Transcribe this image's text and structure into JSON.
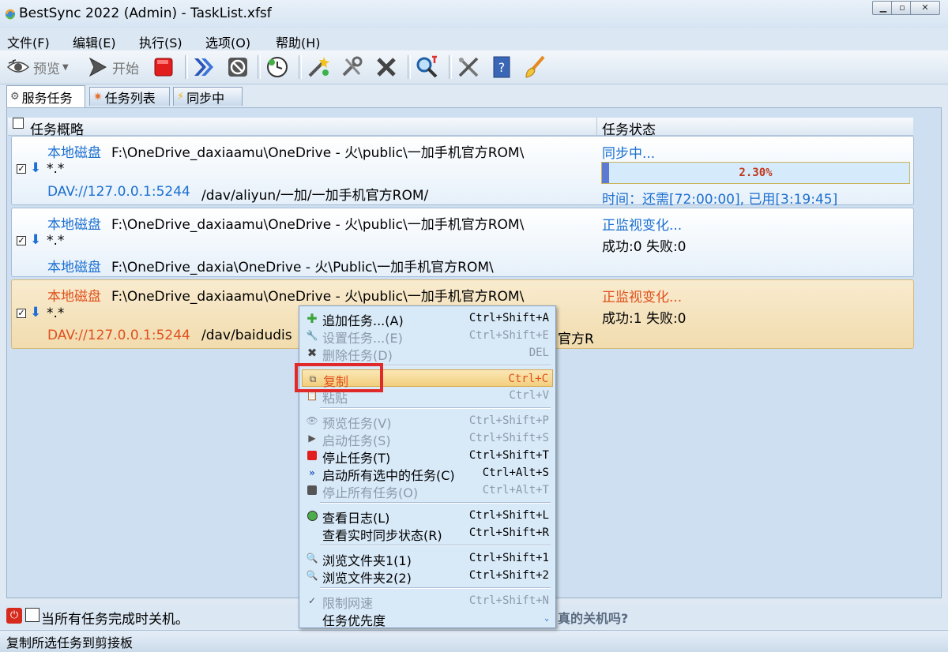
{
  "window": {
    "title": "BestSync 2022 (Admin) - TaskList.xfsf"
  },
  "menu": [
    "文件(F)",
    "编辑(E)",
    "执行(S)",
    "选项(O)",
    "帮助(H)"
  ],
  "toolbar": {
    "preview_label": "预览",
    "start_label": "开始"
  },
  "tabs": [
    "服务任务",
    "任务列表",
    "同步中"
  ],
  "table": {
    "col_overview": "任务概略",
    "col_status": "任务状态"
  },
  "tasks": [
    {
      "src_label": "本地磁盘",
      "src_path": "F:\\OneDrive_daxiaamu\\OneDrive - 火\\public\\一加手机官方ROM\\",
      "filter": "*.*",
      "dst_label": "DAV://127.0.0.1:5244",
      "dst_path": "/dav/aliyun/一加/一加手机官方ROM/",
      "status": "同步中...",
      "progress_text": "2.30%",
      "progress": 0.023,
      "time": "时间：还需[72:00:00], 已用[3:19:45]"
    },
    {
      "src_label": "本地磁盘",
      "src_path": "F:\\OneDrive_daxiaamu\\OneDrive - 火\\public\\一加手机官方ROM\\",
      "filter": "*.*",
      "dst_label": "本地磁盘",
      "dst_path": "F:\\OneDrive_daxia\\OneDrive - 火\\Public\\一加手机官方ROM\\",
      "status": "正监视变化...",
      "result": "成功:0 失败:0"
    },
    {
      "src_label": "本地磁盘",
      "src_path": "F:\\OneDrive_daxiaamu\\OneDrive - 火\\public\\一加手机官方ROM\\",
      "filter": "*.*",
      "dst_label": "DAV://127.0.0.1:5244",
      "dst_path": "/dav/baidudis",
      "dst_tail": "官方R",
      "status": "正监视变化...",
      "result": "成功:1 失败:0"
    }
  ],
  "bottom": {
    "shutdown_label": "当所有任务完成时关机。",
    "confirm_tail": "真的关机吗?"
  },
  "statusbar": {
    "text": "复制所选任务到剪接板"
  },
  "context_menu": {
    "add": {
      "label": "追加任务...(A)",
      "shortcut": "Ctrl+Shift+A"
    },
    "settings": {
      "label": "设置任务...(E)",
      "shortcut": "Ctrl+Shift+E"
    },
    "delete": {
      "label": "删除任务(D)",
      "shortcut": "DEL"
    },
    "copy": {
      "label": "复制",
      "shortcut": "Ctrl+C"
    },
    "paste": {
      "label": "粘贴",
      "shortcut": "Ctrl+V"
    },
    "preview": {
      "label": "预览任务(V)",
      "shortcut": "Ctrl+Shift+P"
    },
    "start": {
      "label": "启动任务(S)",
      "shortcut": "Ctrl+Shift+S"
    },
    "stop": {
      "label": "停止任务(T)",
      "shortcut": "Ctrl+Shift+T"
    },
    "start_all": {
      "label": "启动所有选中的任务(C)",
      "shortcut": "Ctrl+Alt+S"
    },
    "stop_all": {
      "label": "停止所有任务(O)",
      "shortcut": "Ctrl+Alt+T"
    },
    "log": {
      "label": "查看日志(L)",
      "shortcut": "Ctrl+Shift+L"
    },
    "realtime": {
      "label": "查看实时同步状态(R)",
      "shortcut": "Ctrl+Shift+R"
    },
    "browse1": {
      "label": "浏览文件夹1(1)",
      "shortcut": "Ctrl+Shift+1"
    },
    "browse2": {
      "label": "浏览文件夹2(2)",
      "shortcut": "Ctrl+Shift+2"
    },
    "limit": {
      "label": "限制网速",
      "shortcut": "Ctrl+Shift+N"
    },
    "priority": {
      "label": "任务优先度"
    }
  },
  "colors": {
    "accent_blue": "#1b6fd0",
    "selected_orange": "#e0501c",
    "highlight_red": "#e02a2a"
  }
}
